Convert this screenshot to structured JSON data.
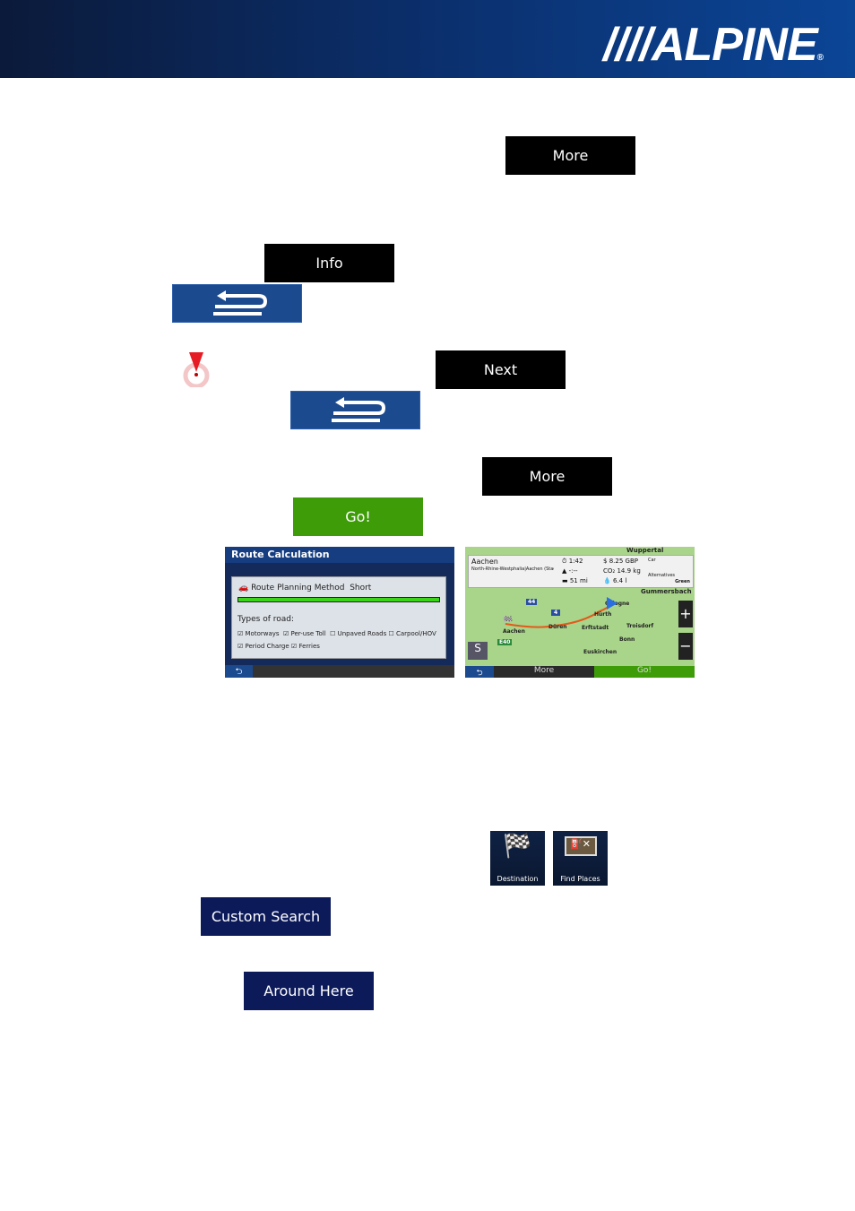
{
  "header": {
    "logo": "ALPINE",
    "registered": "®"
  },
  "buttons": {
    "more1": "More",
    "info": "Info",
    "next": "Next",
    "more2": "More",
    "go": "Go!",
    "custom_search": "Custom Search",
    "around_here": "Around Here"
  },
  "route_calc": {
    "title": "Route Calculation",
    "method_label": "Route Planning Method",
    "method_value": "Short",
    "progress": 1.0,
    "types_label": "Types of road:",
    "road_types": [
      {
        "label": "Motorways",
        "checked": true
      },
      {
        "label": "Per-use Toll",
        "checked": true
      },
      {
        "label": "Unpaved Roads",
        "checked": false
      },
      {
        "label": "Carpool/HOV",
        "checked": false
      },
      {
        "label": "Period Charge",
        "checked": true
      },
      {
        "label": "Ferries",
        "checked": true
      }
    ]
  },
  "route_map": {
    "destination": "Aachen",
    "address": "North-Rhine-Westphalia|Aachen (Stadt) |Nor..",
    "time": "1:42",
    "eta": "-:--",
    "distance": "51",
    "distance_unit": "mi",
    "cost": "8.25",
    "cost_unit": "GBP",
    "co2": "14.9",
    "co2_unit": "kg",
    "fuel": "6.4",
    "fuel_unit": "l",
    "vehicle": "Car",
    "alternatives": "Alternatives",
    "route_type": "Green",
    "cities": [
      "Aachen",
      "Düren",
      "Erftstadt",
      "Hürth",
      "Cologne",
      "Troisdorf",
      "Bonn",
      "Euskirchen",
      "Gummersbach",
      "Wuppertal"
    ],
    "roads": [
      "44",
      "4",
      "E40"
    ],
    "more": "More",
    "go": "Go!"
  },
  "icons": {
    "destination": "Destination",
    "find_places": "Find Places"
  }
}
